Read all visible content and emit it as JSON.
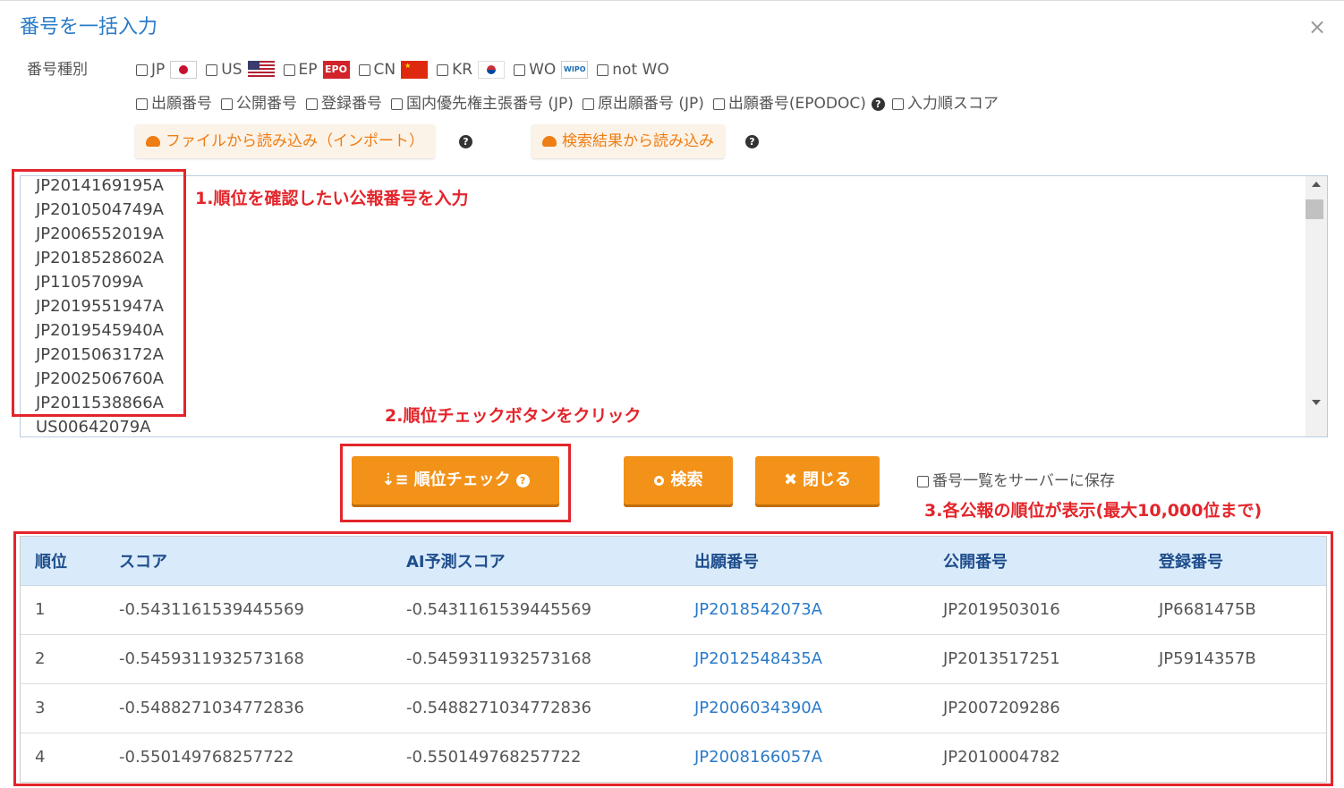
{
  "dialog": {
    "title": "番号を一括入力",
    "close_label": "×"
  },
  "number_type": {
    "label": "番号種別",
    "countries": [
      {
        "label": "JP",
        "flag": "jp-flag-icon"
      },
      {
        "label": "US",
        "flag": "us-flag-icon"
      },
      {
        "label": "EP",
        "flag": "epo-flag-icon",
        "flag_text": "EPO"
      },
      {
        "label": "CN",
        "flag": "cn-flag-icon"
      },
      {
        "label": "KR",
        "flag": "kr-flag-icon"
      },
      {
        "label": "WO",
        "flag": "wipo-flag-icon",
        "flag_text": "WIPO"
      },
      {
        "label": "not WO"
      }
    ],
    "kinds": [
      "出願番号",
      "公開番号",
      "登録番号",
      "国内優先権主張番号 (JP)",
      "原出願番号 (JP)",
      "出願番号(EPODOC)"
    ],
    "order_score": "入力順スコア"
  },
  "import": {
    "file_button": "ファイルから読み込み（インポート）",
    "search_result_button": "検索結果から読み込み"
  },
  "numbers": [
    "JP2014169195A",
    "JP2010504749A",
    "JP2006552019A",
    "JP2018528602A",
    "JP11057099A",
    "JP2019551947A",
    "JP2019545940A",
    "JP2015063172A",
    "JP2002506760A",
    "JP2011538866A",
    "US00642079A"
  ],
  "annotations": {
    "step1": "1.順位を確認したい公報番号を入力",
    "step2": "2.順位チェックボタンをクリック",
    "step3": "3.各公報の順位が表示(最大10,000位まで)"
  },
  "actions": {
    "rank_check": "順位チェック",
    "search": "検索",
    "close": "閉じる",
    "save_label": "番号一覧をサーバーに保存"
  },
  "table": {
    "headers": [
      "順位",
      "スコア",
      "AI予測スコア",
      "出願番号",
      "公開番号",
      "登録番号"
    ],
    "rows": [
      [
        "1",
        "-0.5431161539445569",
        "-0.5431161539445569",
        "JP2018542073A",
        "JP2019503016",
        "JP6681475B"
      ],
      [
        "2",
        "-0.5459311932573168",
        "-0.5459311932573168",
        "JP2012548435A",
        "JP2013517251",
        "JP5914357B"
      ],
      [
        "3",
        "-0.5488271034772836",
        "-0.5488271034772836",
        "JP2006034390A",
        "JP2007209286",
        ""
      ],
      [
        "4",
        "-0.550149768257722",
        "-0.550149768257722",
        "JP2008166057A",
        "JP2010004782",
        ""
      ]
    ]
  },
  "colors": {
    "accent": "#f39219",
    "title_blue": "#2a7bc8",
    "annotation_red": "#e3252b",
    "table_header_bg": "#d9ebfa"
  }
}
